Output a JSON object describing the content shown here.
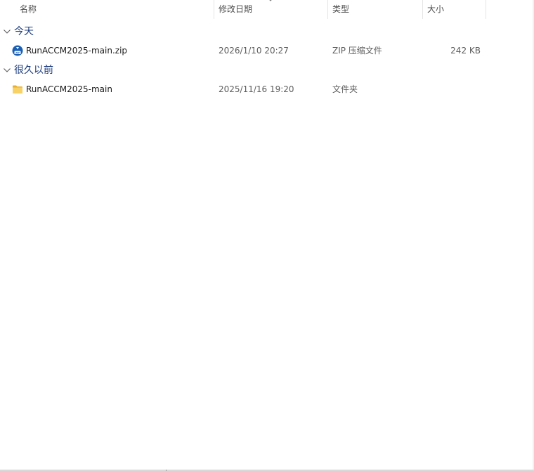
{
  "columns": {
    "name": "名称",
    "date": "修改日期",
    "type": "类型",
    "size": "大小"
  },
  "groups": [
    {
      "title": "今天",
      "items": [
        {
          "name": "RunACCM2025-main.zip",
          "date": "2026/1/10 20:27",
          "type": "ZIP 压缩文件",
          "size": "242 KB",
          "icon": "zip-file-icon"
        }
      ]
    },
    {
      "title": "很久以前",
      "items": [
        {
          "name": "RunACCM2025-main",
          "date": "2025/11/16 19:20",
          "type": "文件夹",
          "size": "",
          "icon": "folder-icon"
        }
      ]
    }
  ],
  "colors": {
    "group_title": "#1c3c7e",
    "header_text": "#4c4c4c",
    "secondary_text": "#5d5d5d",
    "folder": "#f4c84a",
    "zip_badge": "#1a5fb4"
  }
}
